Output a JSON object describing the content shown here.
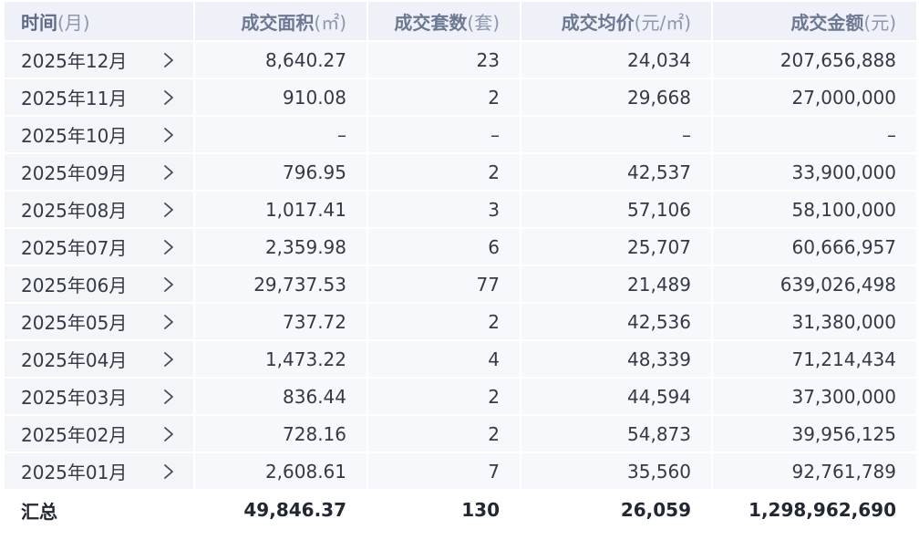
{
  "table": {
    "headers": [
      {
        "label": "时间",
        "unit": "(月)"
      },
      {
        "label": "成交面积",
        "unit": "(㎡)"
      },
      {
        "label": "成交套数",
        "unit": "(套)"
      },
      {
        "label": "成交均价",
        "unit": "(元/㎡)"
      },
      {
        "label": "成交金额",
        "unit": "(元)"
      }
    ],
    "rows": [
      {
        "month": "2025年12月",
        "area": "8,640.27",
        "units": "23",
        "avg_price": "24,034",
        "amount": "207,656,888"
      },
      {
        "month": "2025年11月",
        "area": "910.08",
        "units": "2",
        "avg_price": "29,668",
        "amount": "27,000,000"
      },
      {
        "month": "2025年10月",
        "area": "–",
        "units": "–",
        "avg_price": "–",
        "amount": "–"
      },
      {
        "month": "2025年09月",
        "area": "796.95",
        "units": "2",
        "avg_price": "42,537",
        "amount": "33,900,000"
      },
      {
        "month": "2025年08月",
        "area": "1,017.41",
        "units": "3",
        "avg_price": "57,106",
        "amount": "58,100,000"
      },
      {
        "month": "2025年07月",
        "area": "2,359.98",
        "units": "6",
        "avg_price": "25,707",
        "amount": "60,666,957"
      },
      {
        "month": "2025年06月",
        "area": "29,737.53",
        "units": "77",
        "avg_price": "21,489",
        "amount": "639,026,498"
      },
      {
        "month": "2025年05月",
        "area": "737.72",
        "units": "2",
        "avg_price": "42,536",
        "amount": "31,380,000"
      },
      {
        "month": "2025年04月",
        "area": "1,473.22",
        "units": "4",
        "avg_price": "48,339",
        "amount": "71,214,434"
      },
      {
        "month": "2025年03月",
        "area": "836.44",
        "units": "2",
        "avg_price": "44,594",
        "amount": "37,300,000"
      },
      {
        "month": "2025年02月",
        "area": "728.16",
        "units": "2",
        "avg_price": "54,873",
        "amount": "39,956,125"
      },
      {
        "month": "2025年01月",
        "area": "2,608.61",
        "units": "7",
        "avg_price": "35,560",
        "amount": "92,761,789"
      }
    ],
    "total": {
      "label": "汇总",
      "area": "49,846.37",
      "units": "130",
      "avg_price": "26,059",
      "amount": "1,298,962,690"
    },
    "row_icon": "chevron-right-icon"
  },
  "colors": {
    "header_bg": "#eef1f7",
    "header_text": "#6d7893",
    "row_bg": "#f6f8fb",
    "text": "#333a46"
  }
}
